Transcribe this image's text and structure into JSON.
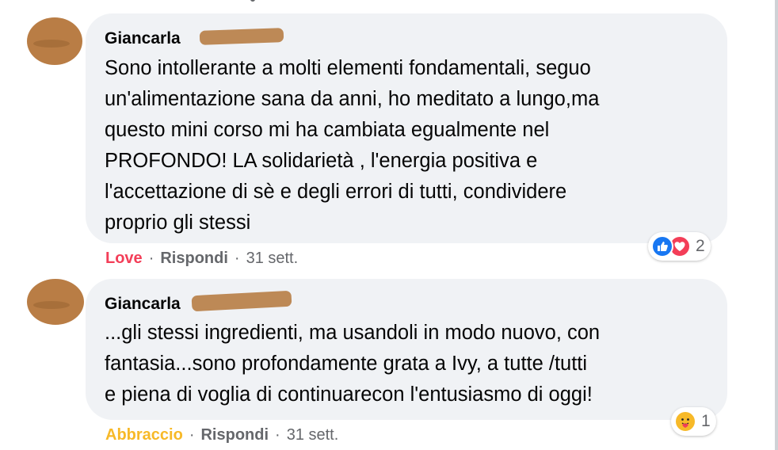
{
  "comments": [
    {
      "author": "Giancarla",
      "lines": [
        "Sono intollerante a molti elementi fondamentali, seguo",
        "un'alimentazione sana da anni, ho meditato a lungo,ma",
        "questo mini corso mi ha cambiata egualmente nel",
        "PROFONDO! LA solidarietà , l'energia positiva e",
        "l'accettazione di sè e degli errori di tutti, condividere",
        "proprio gli stessi"
      ],
      "reaction": "Love",
      "reply": "Rispondi",
      "time": "31 sett.",
      "reaction_count": "2",
      "reaction_icons": [
        "like-icon",
        "heart-icon"
      ]
    },
    {
      "author": "Giancarla",
      "lines": [
        "...gli stessi ingredienti, ma usandoli in modo nuovo, con",
        "fantasia...sono profondamente grata a Ivy, a tutte /tutti",
        "e piena di voglia di continuarecon l'entusiasmo di oggi!"
      ],
      "reaction": "Abbraccio",
      "reply": "Rispondi",
      "time": "31 sett.",
      "reaction_count": "1",
      "reaction_icons": [
        "care-hug-icon"
      ]
    }
  ],
  "separator": "·",
  "colors": {
    "bubble": "#f0f2f5",
    "love": "#f33e58",
    "hug": "#f7b928",
    "meta": "#65676b",
    "like": "#1877f2"
  }
}
